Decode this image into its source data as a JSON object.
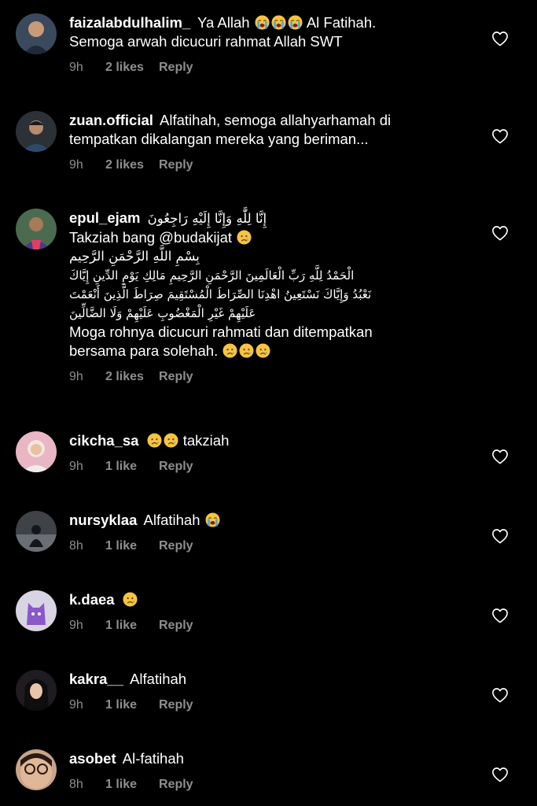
{
  "comments": [
    {
      "username": "faizalabdulhalim_",
      "text1": "Ya Allah",
      "text2": "Al Fatihah.",
      "text3": "Semoga arwah dicucuri rahmat Allah SWT",
      "time": "9h",
      "likes": "2 likes",
      "reply": "Reply",
      "avatar_color": "#3a4a5c"
    },
    {
      "username": "zuan.official",
      "text1": "Alfatihah, semoga allahyarhamah di",
      "text2": "tempatkan dikalangan mereka yang beriman...",
      "time": "9h",
      "likes": "2 likes",
      "reply": "Reply",
      "avatar_color": "#2c3138"
    },
    {
      "username": "epul_ejam",
      "arabic1": "إِنَّا لِلَّٰهِ وَإِنَّا إِلَيْهِ رَاجِعُونَ",
      "text1": "Takziah bang",
      "mention": "@budakijat",
      "arabic2": "بِسْمِ اللَّهِ الرَّحْمَنِ الرَّحِيم",
      "arabic3": "الْحَمْدُ لِلَّهِ رَبِّ الْعَالَمِينَ  الرَّحْمَنِ الرَّحِيمِ  مَالِكِ يَوْمِ الدِّينِ  إِيَّاكَ",
      "arabic4": "نَعْبُدُ وَإِيَّاكَ نَسْتَعِينُ  اهْدِنَا الصِّرَاطَ الْمُسْتَقِيمَ  صِرَاطَ الَّذِينَ أَنْعَمْتَ",
      "arabic5": "عَلَيْهِمْ غَيْرِ الْمَغْضُوبِ عَلَيْهِمْ وَلَا الضَّالِّينَ",
      "text2": "Moga rohnya dicucuri rahmati dan ditempatkan",
      "text3": "bersama para solehah.",
      "time": "9h",
      "likes": "2 likes",
      "reply": "Reply",
      "avatar_color": "#4b6b4f"
    },
    {
      "username": "cikcha_sa",
      "text1": "takziah",
      "time": "9h",
      "likes": "1 like",
      "reply": "Reply",
      "avatar_color": "#e8b6c4"
    },
    {
      "username": "nursyklaa",
      "text1": "Alfatihah",
      "time": "8h",
      "likes": "1 like",
      "reply": "Reply",
      "avatar_color": "#3f4247"
    },
    {
      "username": "k.daea",
      "time": "9h",
      "likes": "1 like",
      "reply": "Reply",
      "avatar_color": "#d9d4e4"
    },
    {
      "username": "kakra__",
      "text1": "Alfatihah",
      "time": "9h",
      "likes": "1 like",
      "reply": "Reply",
      "avatar_color": "#1e1c20"
    },
    {
      "username": "asobet",
      "text1": "Al-fatihah",
      "time": "8h",
      "likes": "1 like",
      "reply": "Reply",
      "avatar_color": "#c8a48c"
    }
  ],
  "colors": {
    "background": "#000000",
    "text": "#ffffff",
    "meta": "#8e8e8e",
    "emoji_face": "#f6c442",
    "emoji_tear": "#4aa3e8"
  },
  "icons": {
    "heart": "heart-outline-icon",
    "crying": "crying-face-emoji",
    "sobbing": "loudly-crying-face-emoji"
  }
}
